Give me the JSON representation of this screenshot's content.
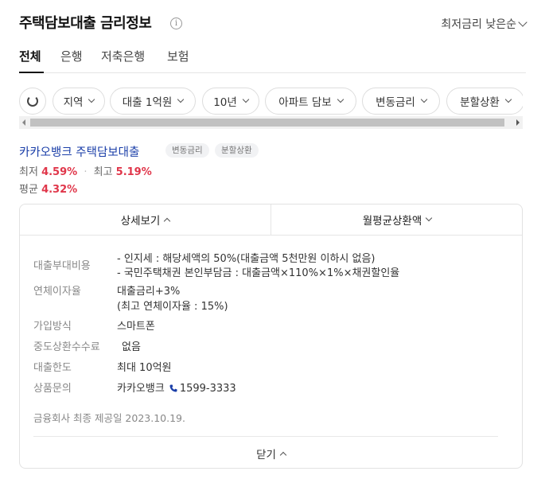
{
  "header": {
    "title": "주택담보대출 금리정보",
    "info_icon": "i",
    "sort_label": "최저금리 낮은순"
  },
  "tabs": [
    {
      "label": "전체",
      "active": true
    },
    {
      "label": "은행",
      "active": false
    },
    {
      "label": "저축은행",
      "active": false
    },
    {
      "label": "보험",
      "active": false
    }
  ],
  "filters": [
    "지역",
    "대출 1억원",
    "10년",
    "아파트 담보",
    "변동금리",
    "분할상환"
  ],
  "product": {
    "name": "카카오뱅크 주택담보대출",
    "badges": [
      "변동금리",
      "분할상환"
    ],
    "min_label": "최저",
    "min_rate": "4.59%",
    "max_label": "최고",
    "max_rate": "5.19%",
    "avg_label": "평균",
    "avg_rate": "4.32%"
  },
  "detail": {
    "tab_detail": "상세보기",
    "tab_monthly": "월평균상환액",
    "rows": {
      "fee_label": "대출부대비용",
      "fee_line1": "- 인지세 : 해당세액의 50%(대출금액 5천만원 이하시 없음)",
      "fee_line2": "- 국민주택채권 본인부담금 : 대출금액×110%×1%×채권할인율",
      "overdue_label": "연체이자율",
      "overdue_line1": "대출금리+3%",
      "overdue_line2": "(최고 연체이자율 : 15%)",
      "join_label": "가입방식",
      "join_value": "스마트폰",
      "prepay_label": "중도상환수수료",
      "prepay_value": "없음",
      "limit_label": "대출한도",
      "limit_value": "최대 10억원",
      "inquiry_label": "상품문의",
      "inquiry_company": "카카오뱅크",
      "inquiry_phone": "1599-3333"
    },
    "footnote": "금융회사 최종 제공일 2023.10.19.",
    "close_label": "닫기"
  },
  "colors": {
    "rate_red": "#e0364a",
    "link_blue": "#1a3ea8"
  }
}
